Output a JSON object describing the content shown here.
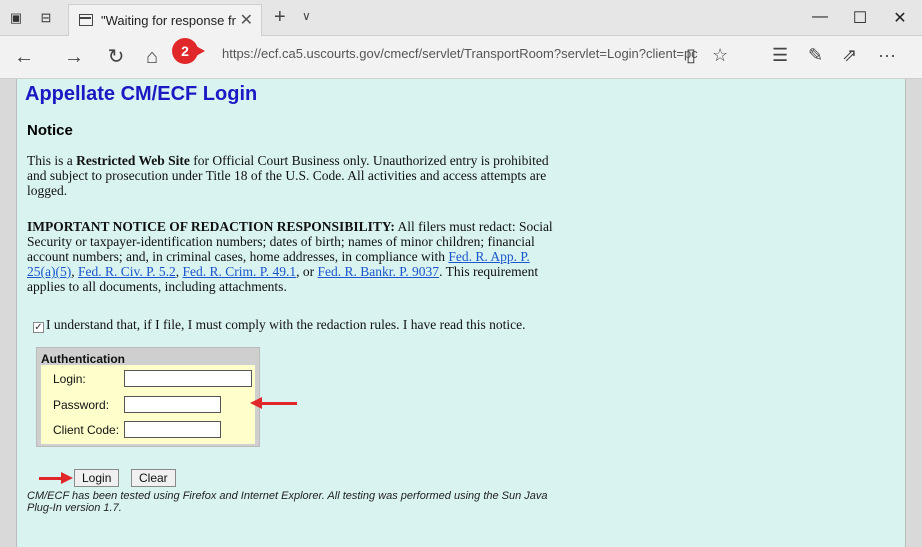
{
  "browser": {
    "tab_title": "\"Waiting for response fr",
    "tab_close": "✕",
    "new_tab": "+",
    "tab_list": "∨",
    "minimize": "—",
    "maximize": "☐",
    "close": "✕",
    "back": "←",
    "forward": "→",
    "refresh": "↻",
    "home": "⌂",
    "badge": "2",
    "url": "https://ecf.ca5.uscourts.gov/cmecf/servlet/TransportRoom?servlet=Login?client=pc",
    "more": "···"
  },
  "page": {
    "title": "Appellate CM/ECF Login",
    "notice_heading": "Notice",
    "p1_pre": "This is a ",
    "p1_bold": "Restricted Web Site",
    "p1_post": " for Official Court Business only. Unauthorized entry is prohibited and subject to prosecution under Title 18 of the U.S. Code. All activities and access attempts are logged.",
    "p2_bold": "IMPORTANT NOTICE OF REDACTION RESPONSIBILITY:",
    "p2_text": " All filers must redact: Social Security or taxpayer-identification numbers; dates of birth; names of minor children; financial account numbers; and, in criminal cases, home addresses, in compliance with ",
    "link_app": "Fed. R. App. P. 25(a)(5)",
    "sep1": ", ",
    "link_civ": "Fed. R. Civ. P. 5.2",
    "sep2": ", ",
    "link_crim": "Fed. R. Crim. P. 49.1",
    "sep3": ", or ",
    "link_bankr": "Fed. R. Bankr. P. 9037",
    "p2_end": ". This requirement applies to all documents, including attachments.",
    "checkbox_mark": "✓",
    "checkbox_label": "I understand that, if I file, I must comply with the redaction rules. I have read this notice.",
    "auth_title": "Authentication",
    "login_label": "Login:",
    "password_label": "Password:",
    "client_code_label": "Client Code:",
    "login_button": "Login",
    "clear_button": "Clear",
    "footnote": "CM/ECF has been tested using Firefox and Internet Explorer. All testing was performed using the Sun Java Plug-In version 1.7."
  },
  "colors": {
    "annotation_red": "#e0282a",
    "page_bg": "#d9f3f0",
    "title_blue": "#1a1ac4"
  }
}
